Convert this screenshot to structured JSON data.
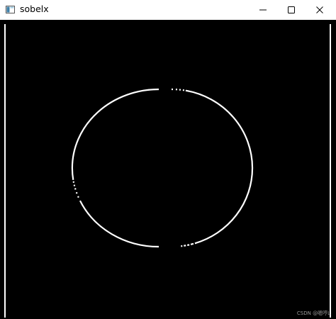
{
  "window": {
    "title": "sobelx",
    "icon": "app-window-icon"
  },
  "controls": {
    "minimize_icon": "minimize-icon",
    "maximize_icon": "maximize-icon",
    "close_icon": "close-icon"
  },
  "image": {
    "background_color": "#000000",
    "edge_color": "#ffffff",
    "content": "ellipse-edge"
  },
  "watermark": {
    "text": "CSDN @嗯哼L"
  }
}
